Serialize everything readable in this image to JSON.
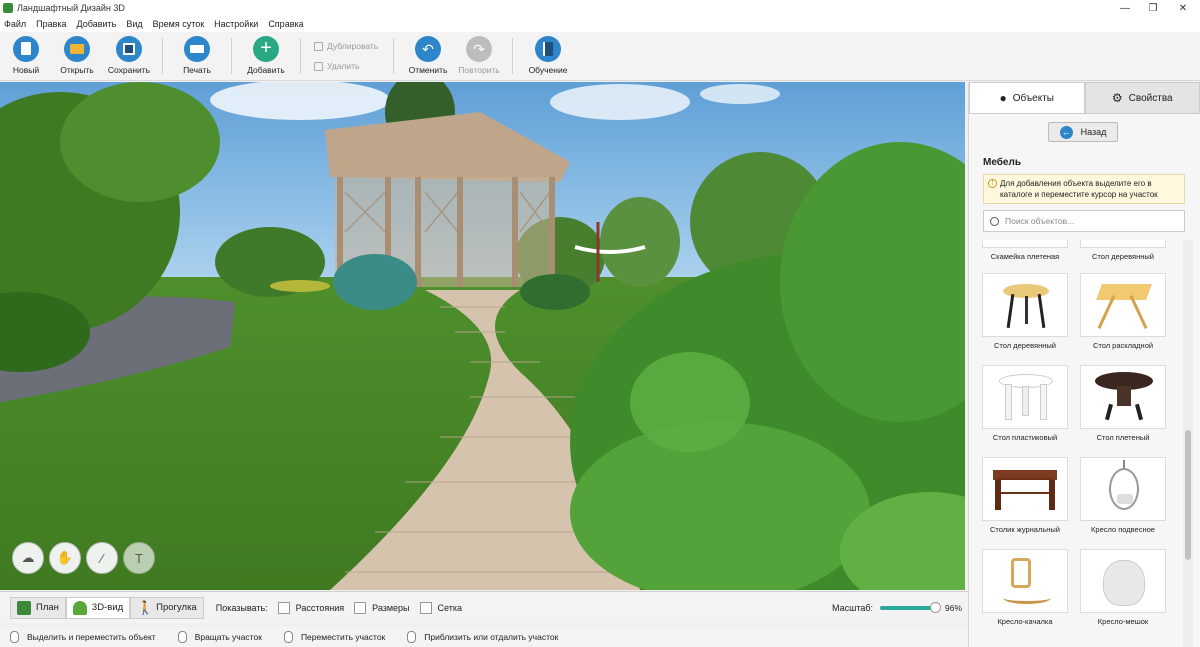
{
  "window": {
    "title": "Ландшафтный Дизайн 3D",
    "controls": [
      "—",
      "❐",
      "✕"
    ]
  },
  "menu": [
    "Файл",
    "Правка",
    "Добавить",
    "Вид",
    "Время суток",
    "Настройки",
    "Справка"
  ],
  "toolbar": {
    "new": "Новый",
    "open": "Открыть",
    "save": "Сохранить",
    "print": "Печать",
    "add": "Добавить",
    "duplicate": "Дублировать",
    "delete": "Удалить",
    "undo": "Отменить",
    "redo": "Повторить",
    "tutorial": "Обучение"
  },
  "panel": {
    "tab_objects": "Объекты",
    "tab_properties": "Свойства",
    "back": "Назад",
    "category": "Мебель",
    "hint": "Для добавления объекта выделите его в каталоге и переместите курсор на участок",
    "search_placeholder": "Поиск объектов..."
  },
  "catalog": [
    {
      "name": "Скамейка плетеная"
    },
    {
      "name": "Стол деревянный"
    },
    {
      "name": "Стол деревянный"
    },
    {
      "name": "Стол раскладной"
    },
    {
      "name": "Стол пластиковый"
    },
    {
      "name": "Стол плетеный"
    },
    {
      "name": "Столик журнальный"
    },
    {
      "name": "Кресло подвесное"
    },
    {
      "name": "Кресло-качалка"
    },
    {
      "name": "Кресло-мешок"
    }
  ],
  "bottom": {
    "plan": "План",
    "view3d": "3D-вид",
    "walk": "Прогулка",
    "show_label": "Показывать:",
    "distances": "Расстояния",
    "sizes": "Размеры",
    "grid": "Сетка",
    "scale_label": "Масштаб:",
    "scale_value": "96%"
  },
  "status": {
    "select": "Выделить и переместить объект",
    "rotate": "Вращать участок",
    "move": "Переместить участок",
    "zoom": "Приблизить или отдалить участок"
  },
  "colors": {
    "accent_blue": "#2d86c9",
    "accent_green": "#2aa884",
    "sky": "#8cc3e8",
    "lawn": "#4a8a2a",
    "path": "#d8c6b2"
  }
}
